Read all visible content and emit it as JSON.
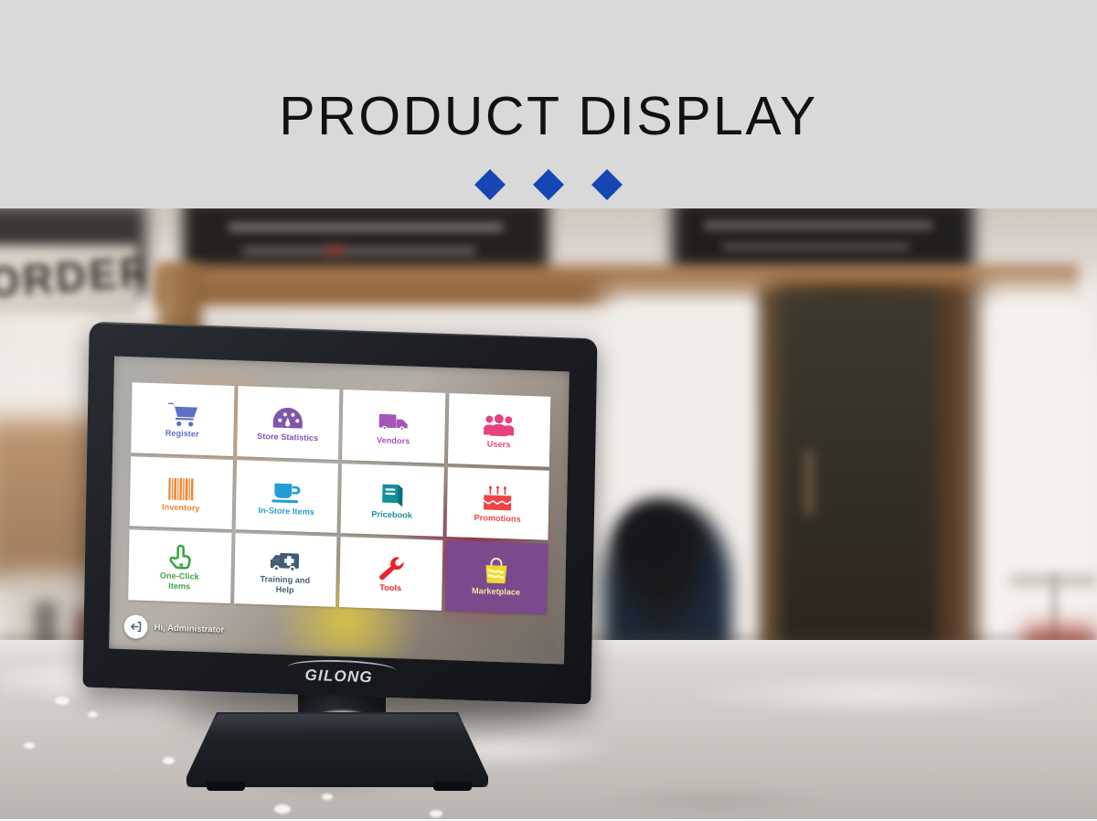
{
  "header": {
    "title": "PRODUCT DISPLAY",
    "accent_color": "#1546b4",
    "band_color": "#d9d9d9",
    "decorations": [
      "diamond",
      "diamond",
      "diamond"
    ]
  },
  "scene": {
    "setting": "blurred cafe counter",
    "background_sign_text": "ORDER HERE",
    "counter_surface": "marble countertop"
  },
  "device": {
    "brand": "GILONG",
    "form_factor": "touchscreen POS terminal"
  },
  "pos_ui": {
    "tiles": [
      {
        "label": "Register",
        "icon": "shopping-cart-icon",
        "color": "#4a5fc1",
        "tile_style": "light"
      },
      {
        "label": "Store Statistics",
        "icon": "gauge-icon",
        "color": "#7a50a8",
        "tile_style": "light"
      },
      {
        "label": "Vendors",
        "icon": "delivery-truck-icon",
        "color": "#a355b8",
        "tile_style": "light"
      },
      {
        "label": "Users",
        "icon": "users-group-icon",
        "color": "#e8417f",
        "tile_style": "light"
      },
      {
        "label": "Inventory",
        "icon": "barcode-icon",
        "color": "#f07a1e",
        "tile_style": "light"
      },
      {
        "label": "In-Store Items",
        "icon": "coffee-cup-icon",
        "color": "#1e9ad6",
        "tile_style": "light"
      },
      {
        "label": "Pricebook",
        "icon": "book-icon",
        "color": "#12909b",
        "tile_style": "light"
      },
      {
        "label": "Promotions",
        "icon": "birthday-cake-icon",
        "color": "#ee4444",
        "tile_style": "light"
      },
      {
        "label": "One-Click\nItems",
        "icon": "pointing-hand-icon",
        "color": "#35a13a",
        "tile_style": "light"
      },
      {
        "label": "Training and\nHelp",
        "icon": "ambulance-icon",
        "color": "#3d5a73",
        "tile_style": "light"
      },
      {
        "label": "Tools",
        "icon": "wrench-icon",
        "color": "#e8242a",
        "tile_style": "light"
      },
      {
        "label": "Marketplace",
        "icon": "shopping-bag-icon",
        "color": "#f2e7a0",
        "tile_style": "accent",
        "tile_bg": "#7b4a8c"
      }
    ],
    "status_bar": {
      "greeting": "Hi, Administrator",
      "back_icon": "logout-arrow-icon"
    }
  }
}
